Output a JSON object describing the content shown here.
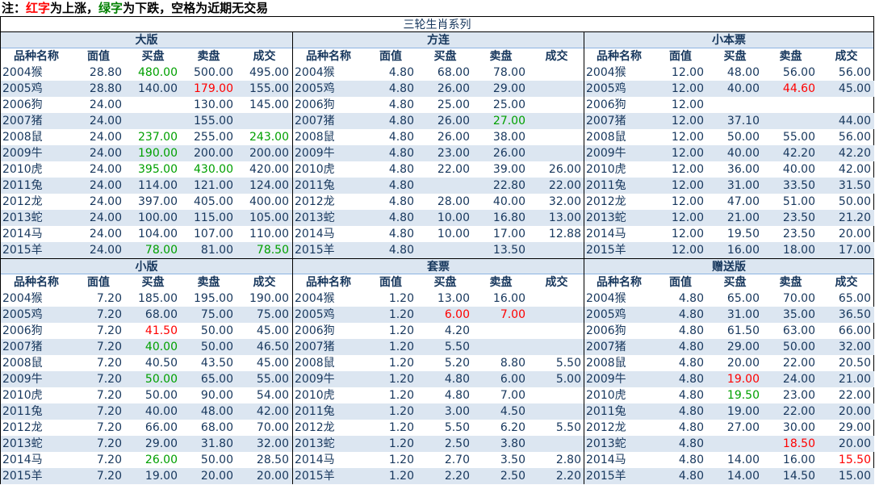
{
  "note": {
    "prefix": "注：",
    "red_word": "红字",
    "mid1": "为上涨，",
    "green_word": "绿字",
    "mid2": "为下跌，空格为近期无交易"
  },
  "title": "三轮生肖系列",
  "headers": [
    "品种名称",
    "面值",
    "买盘",
    "卖盘",
    "成交"
  ],
  "colors": {
    "up": "#ff0000",
    "down": "#00a000",
    "text": "#17375d",
    "band": "#dce6f1"
  },
  "panels": [
    {
      "title": "大版",
      "rows": [
        {
          "name": "2004猴",
          "face": "28.80",
          "buy": "480.00",
          "sell": "500.00",
          "deal": "495.00",
          "buy_c": "down"
        },
        {
          "name": "2005鸡",
          "face": "28.80",
          "buy": "140.00",
          "sell": "179.00",
          "deal": "155.00",
          "sell_c": "up"
        },
        {
          "name": "2006狗",
          "face": "24.00",
          "buy": "",
          "sell": "130.00",
          "deal": "145.00"
        },
        {
          "name": "2007猪",
          "face": "24.00",
          "buy": "",
          "sell": "155.00",
          "deal": ""
        },
        {
          "name": "2008鼠",
          "face": "24.00",
          "buy": "237.00",
          "sell": "255.00",
          "deal": "243.00",
          "buy_c": "down",
          "deal_c": "down"
        },
        {
          "name": "2009牛",
          "face": "24.00",
          "buy": "190.00",
          "sell": "200.00",
          "deal": "200.00",
          "buy_c": "down"
        },
        {
          "name": "2010虎",
          "face": "24.00",
          "buy": "395.00",
          "sell": "430.00",
          "deal": "420.00",
          "buy_c": "down",
          "sell_c": "down"
        },
        {
          "name": "2011兔",
          "face": "24.00",
          "buy": "114.00",
          "sell": "121.00",
          "deal": "124.00"
        },
        {
          "name": "2012龙",
          "face": "24.00",
          "buy": "397.00",
          "sell": "405.00",
          "deal": "400.00"
        },
        {
          "name": "2013蛇",
          "face": "24.00",
          "buy": "100.00",
          "sell": "115.00",
          "deal": "105.00"
        },
        {
          "name": "2014马",
          "face": "24.00",
          "buy": "104.00",
          "sell": "107.00",
          "deal": "110.00"
        },
        {
          "name": "2015羊",
          "face": "24.00",
          "buy": "78.00",
          "sell": "81.00",
          "deal": "78.50",
          "buy_c": "down",
          "deal_c": "down"
        }
      ]
    },
    {
      "title": "方连",
      "rows": [
        {
          "name": "2004猴",
          "face": "4.80",
          "buy": "68.00",
          "sell": "78.00",
          "deal": ""
        },
        {
          "name": "2005鸡",
          "face": "4.80",
          "buy": "26.00",
          "sell": "29.00",
          "deal": ""
        },
        {
          "name": "2006狗",
          "face": "4.80",
          "buy": "25.00",
          "sell": "25.00",
          "deal": ""
        },
        {
          "name": "2007猪",
          "face": "4.80",
          "buy": "26.00",
          "sell": "27.00",
          "deal": "",
          "sell_c": "down"
        },
        {
          "name": "2008鼠",
          "face": "4.80",
          "buy": "26.00",
          "sell": "38.00",
          "deal": ""
        },
        {
          "name": "2009牛",
          "face": "4.80",
          "buy": "23.00",
          "sell": "26.00",
          "deal": ""
        },
        {
          "name": "2010虎",
          "face": "4.80",
          "buy": "22.00",
          "sell": "39.00",
          "deal": "26.00"
        },
        {
          "name": "2011兔",
          "face": "4.80",
          "buy": "",
          "sell": "22.80",
          "deal": "22.00"
        },
        {
          "name": "2012龙",
          "face": "4.80",
          "buy": "28.00",
          "sell": "40.00",
          "deal": "32.00"
        },
        {
          "name": "2013蛇",
          "face": "4.80",
          "buy": "10.00",
          "sell": "16.80",
          "deal": "13.00"
        },
        {
          "name": "2014马",
          "face": "4.80",
          "buy": "10.00",
          "sell": "17.00",
          "deal": "12.88"
        },
        {
          "name": "2015羊",
          "face": "4.80",
          "buy": "",
          "sell": "13.50",
          "deal": ""
        }
      ]
    },
    {
      "title": "小本票",
      "rows": [
        {
          "name": "2004猴",
          "face": "12.00",
          "buy": "48.00",
          "sell": "56.00",
          "deal": "56.00"
        },
        {
          "name": "2005鸡",
          "face": "12.00",
          "buy": "40.00",
          "sell": "44.60",
          "deal": "45.00",
          "sell_c": "up"
        },
        {
          "name": "2006狗",
          "face": "12.00",
          "buy": "",
          "sell": "",
          "deal": ""
        },
        {
          "name": "2007猪",
          "face": "12.00",
          "buy": "37.10",
          "sell": "",
          "deal": "44.00"
        },
        {
          "name": "2008鼠",
          "face": "12.00",
          "buy": "50.00",
          "sell": "55.00",
          "deal": "56.00"
        },
        {
          "name": "2009牛",
          "face": "12.00",
          "buy": "40.00",
          "sell": "42.20",
          "deal": "42.20"
        },
        {
          "name": "2010虎",
          "face": "12.00",
          "buy": "36.00",
          "sell": "40.00",
          "deal": "42.00"
        },
        {
          "name": "2011兔",
          "face": "12.00",
          "buy": "31.00",
          "sell": "33.50",
          "deal": "31.50"
        },
        {
          "name": "2012龙",
          "face": "12.00",
          "buy": "47.00",
          "sell": "51.00",
          "deal": "50.00"
        },
        {
          "name": "2013蛇",
          "face": "12.00",
          "buy": "21.00",
          "sell": "23.50",
          "deal": "21.20"
        },
        {
          "name": "2014马",
          "face": "12.00",
          "buy": "19.50",
          "sell": "23.50",
          "deal": "20.00"
        },
        {
          "name": "2015羊",
          "face": "12.00",
          "buy": "16.00",
          "sell": "18.00",
          "deal": "17.00"
        }
      ]
    },
    {
      "title": "小版",
      "rows": [
        {
          "name": "2004猴",
          "face": "7.20",
          "buy": "185.00",
          "sell": "195.00",
          "deal": "190.00"
        },
        {
          "name": "2005鸡",
          "face": "7.20",
          "buy": "68.00",
          "sell": "75.00",
          "deal": "75.00"
        },
        {
          "name": "2006狗",
          "face": "7.20",
          "buy": "41.50",
          "sell": "50.00",
          "deal": "45.00",
          "buy_c": "up"
        },
        {
          "name": "2007猪",
          "face": "7.20",
          "buy": "40.00",
          "sell": "50.00",
          "deal": "46.50",
          "buy_c": "down"
        },
        {
          "name": "2008鼠",
          "face": "7.20",
          "buy": "40.50",
          "sell": "43.50",
          "deal": "45.00"
        },
        {
          "name": "2009牛",
          "face": "7.20",
          "buy": "50.00",
          "sell": "65.00",
          "deal": "55.00",
          "buy_c": "down"
        },
        {
          "name": "2010虎",
          "face": "7.20",
          "buy": "50.00",
          "sell": "90.00",
          "deal": "54.00"
        },
        {
          "name": "2011兔",
          "face": "7.20",
          "buy": "40.00",
          "sell": "48.00",
          "deal": "42.00"
        },
        {
          "name": "2012龙",
          "face": "7.20",
          "buy": "66.00",
          "sell": "68.00",
          "deal": "70.00"
        },
        {
          "name": "2013蛇",
          "face": "7.20",
          "buy": "29.00",
          "sell": "31.80",
          "deal": "32.00"
        },
        {
          "name": "2014马",
          "face": "7.20",
          "buy": "26.00",
          "sell": "50.00",
          "deal": "28.50",
          "buy_c": "down"
        },
        {
          "name": "2015羊",
          "face": "7.20",
          "buy": "19.00",
          "sell": "20.00",
          "deal": "20.00"
        }
      ]
    },
    {
      "title": "套票",
      "rows": [
        {
          "name": "2004猴",
          "face": "1.20",
          "buy": "13.00",
          "sell": "16.00",
          "deal": ""
        },
        {
          "name": "2005鸡",
          "face": "1.20",
          "buy": "6.00",
          "sell": "7.00",
          "deal": "",
          "buy_c": "up",
          "sell_c": "up"
        },
        {
          "name": "2006狗",
          "face": "1.20",
          "buy": "4.20",
          "sell": "",
          "deal": ""
        },
        {
          "name": "2007猪",
          "face": "1.20",
          "buy": "5.50",
          "sell": "",
          "deal": ""
        },
        {
          "name": "2008鼠",
          "face": "1.20",
          "buy": "5.20",
          "sell": "8.80",
          "deal": "5.50"
        },
        {
          "name": "2009牛",
          "face": "1.20",
          "buy": "4.80",
          "sell": "6.00",
          "deal": "5.00"
        },
        {
          "name": "2010虎",
          "face": "1.20",
          "buy": "4.80",
          "sell": "7.00",
          "deal": ""
        },
        {
          "name": "2011兔",
          "face": "1.20",
          "buy": "3.00",
          "sell": "4.50",
          "deal": ""
        },
        {
          "name": "2012龙",
          "face": "1.20",
          "buy": "5.50",
          "sell": "6.20",
          "deal": "5.50"
        },
        {
          "name": "2013蛇",
          "face": "1.20",
          "buy": "2.50",
          "sell": "3.80",
          "deal": ""
        },
        {
          "name": "2014马",
          "face": "1.20",
          "buy": "2.70",
          "sell": "3.50",
          "deal": "2.80"
        },
        {
          "name": "2015羊",
          "face": "1.20",
          "buy": "2.20",
          "sell": "2.50",
          "deal": "2.20"
        }
      ]
    },
    {
      "title": "赠送版",
      "rows": [
        {
          "name": "2004猴",
          "face": "4.80",
          "buy": "65.00",
          "sell": "70.00",
          "deal": "65.00"
        },
        {
          "name": "2005鸡",
          "face": "4.80",
          "buy": "31.00",
          "sell": "35.00",
          "deal": "36.50"
        },
        {
          "name": "2006狗",
          "face": "4.80",
          "buy": "61.50",
          "sell": "63.00",
          "deal": "66.00"
        },
        {
          "name": "2007猪",
          "face": "4.80",
          "buy": "29.00",
          "sell": "50.00",
          "deal": "32.00"
        },
        {
          "name": "2008鼠",
          "face": "4.80",
          "buy": "20.00",
          "sell": "22.00",
          "deal": "20.50"
        },
        {
          "name": "2009牛",
          "face": "4.80",
          "buy": "19.00",
          "sell": "24.00",
          "deal": "21.00",
          "buy_c": "up"
        },
        {
          "name": "2010虎",
          "face": "4.80",
          "buy": "19.50",
          "sell": "23.00",
          "deal": "22.00",
          "buy_c": "down"
        },
        {
          "name": "2011兔",
          "face": "4.80",
          "buy": "19.00",
          "sell": "22.00",
          "deal": "20.00"
        },
        {
          "name": "2012龙",
          "face": "4.80",
          "buy": "27.00",
          "sell": "30.00",
          "deal": "29.00"
        },
        {
          "name": "2013蛇",
          "face": "4.80",
          "buy": "",
          "sell": "18.50",
          "deal": "20.00",
          "sell_c": "up"
        },
        {
          "name": "2014马",
          "face": "4.80",
          "buy": "14.00",
          "sell": "16.00",
          "deal": "15.50",
          "deal_c": "up"
        },
        {
          "name": "2015羊",
          "face": "4.80",
          "buy": "14.00",
          "sell": "14.50",
          "deal": "15.00"
        }
      ]
    }
  ]
}
